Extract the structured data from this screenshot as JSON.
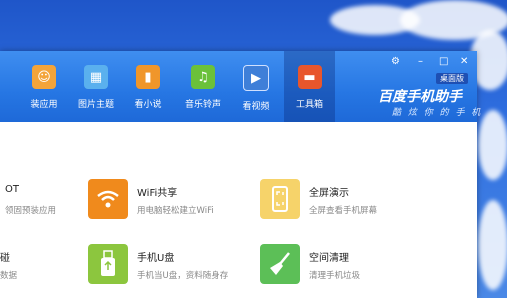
{
  "nav": {
    "items": [
      {
        "label": "装应用",
        "icon": "shopping-bag-icon",
        "color": "#f3a43a"
      },
      {
        "label": "图片主题",
        "icon": "picture-icon",
        "color": "#5ab0ee"
      },
      {
        "label": "看小说",
        "icon": "book-icon",
        "color": "#f0962a"
      },
      {
        "label": "音乐铃声",
        "icon": "music-note-icon",
        "color": "#6bc13a"
      },
      {
        "label": "看视频",
        "icon": "video-film-icon",
        "color": "#3f7fd8"
      },
      {
        "label": "工具箱",
        "icon": "toolbox-icon",
        "color": "#e8562c"
      }
    ],
    "active": "工具箱"
  },
  "window_controls": {
    "settings": "⚙",
    "minimize": "–",
    "maximize": "□",
    "close": "✕"
  },
  "brand": {
    "badge": "桌面版",
    "name": "百度手机助手",
    "slogan": "酷 炫 你 的 手 机"
  },
  "tools": [
    {
      "title": "OT",
      "desc": "领固预装应用",
      "icon": "partial-tool-icon",
      "color": "#ffffff"
    },
    {
      "title": "WiFi共享",
      "desc": "用电脑轻松建立WiFi",
      "icon": "wifi-icon",
      "color": "#f08a1c"
    },
    {
      "title": "全屏演示",
      "desc": "全屏查看手机屏幕",
      "icon": "fullscreen-phone-icon",
      "color": "#f6d36a"
    },
    {
      "title": "碰",
      "desc": "数据",
      "icon": "partial-tool-icon",
      "color": "#ffffff"
    },
    {
      "title": "手机U盘",
      "desc": "手机当U盘，资料随身存",
      "icon": "usb-drive-icon",
      "color": "#8cc63e"
    },
    {
      "title": "空间清理",
      "desc": "清理手机垃圾",
      "icon": "broom-icon",
      "color": "#5cbf57"
    }
  ]
}
